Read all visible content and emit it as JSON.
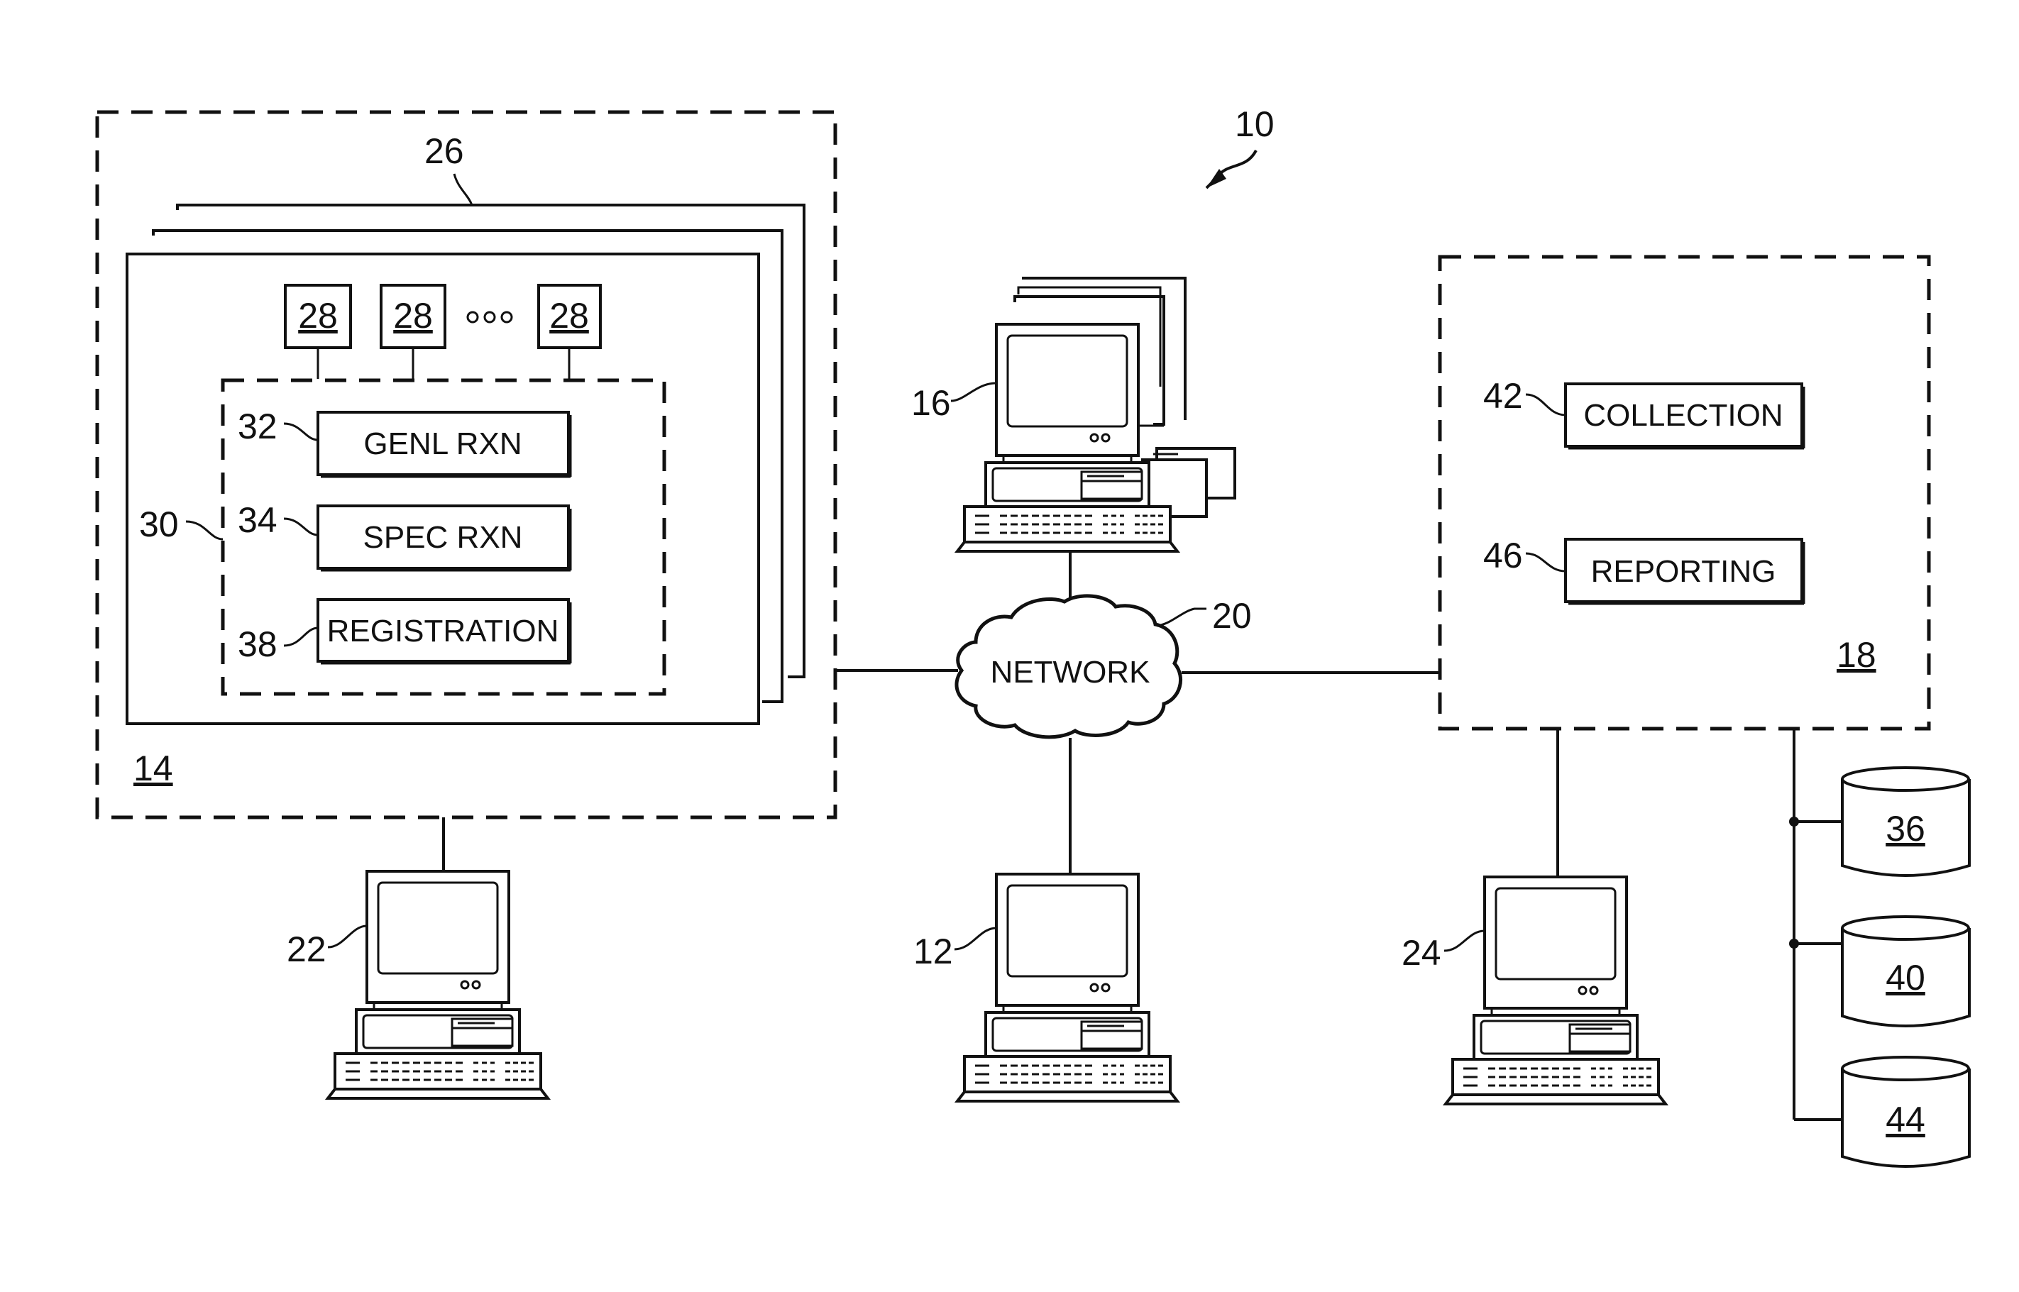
{
  "figure": {
    "system_ref": "10",
    "network": {
      "ref": "20",
      "label": "NETWORK"
    },
    "server_14": {
      "ref": "14",
      "stack_ref": "26",
      "modules": [
        "28",
        "28",
        "28"
      ],
      "ellipsis": "ooo",
      "group": {
        "ref": "30",
        "blocks": [
          {
            "ref": "32",
            "label": "GENL RXN"
          },
          {
            "ref": "34",
            "label": "SPEC RXN"
          },
          {
            "ref": "38",
            "label": "REGISTRATION"
          }
        ]
      }
    },
    "server_18": {
      "ref": "18",
      "blocks": [
        {
          "ref": "42",
          "label": "COLLECTION"
        },
        {
          "ref": "46",
          "label": "REPORTING"
        }
      ]
    },
    "computers": [
      {
        "ref": "16",
        "role": "client workstations (stacked)"
      },
      {
        "ref": "22",
        "role": "terminal for server 14"
      },
      {
        "ref": "12",
        "role": "terminal on network"
      },
      {
        "ref": "24",
        "role": "terminal for server 18"
      }
    ],
    "databases": [
      {
        "ref": "36"
      },
      {
        "ref": "40"
      },
      {
        "ref": "44"
      }
    ]
  }
}
